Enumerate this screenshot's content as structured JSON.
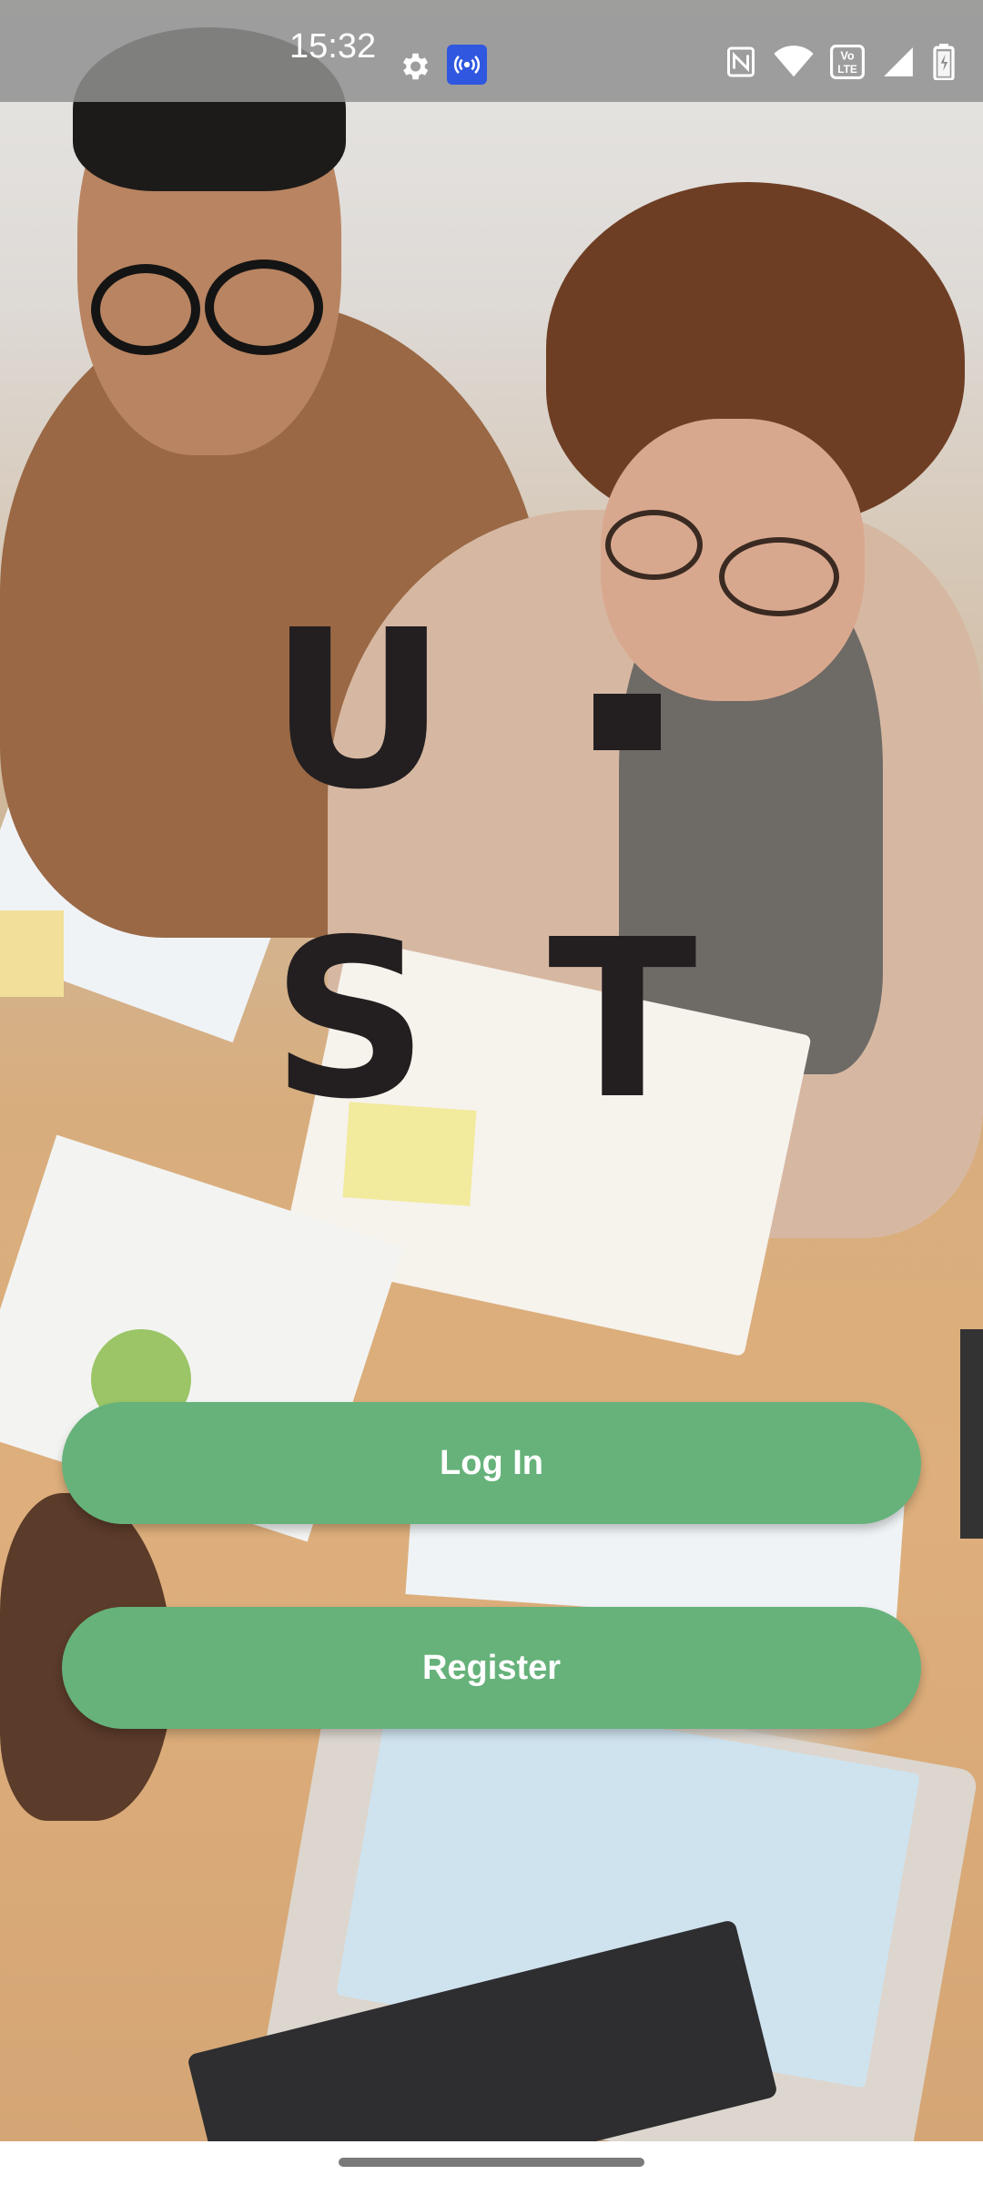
{
  "status_bar": {
    "time": "15:32",
    "icons": [
      "settings-icon",
      "cast-icon",
      "nfc-icon",
      "wifi-icon",
      "volte-icon",
      "signal-icon",
      "battery-icon"
    ],
    "volte_text": "Vo LTE"
  },
  "logo": {
    "letters_top": "U",
    "letters_bottom_left": "S",
    "letters_bottom_right": "T"
  },
  "buttons": {
    "login_label": "Log In",
    "register_label": "Register"
  },
  "colors": {
    "button_green": "#66b27a",
    "logo_dark": "#231f20",
    "cast_blue": "#2f57e0"
  }
}
